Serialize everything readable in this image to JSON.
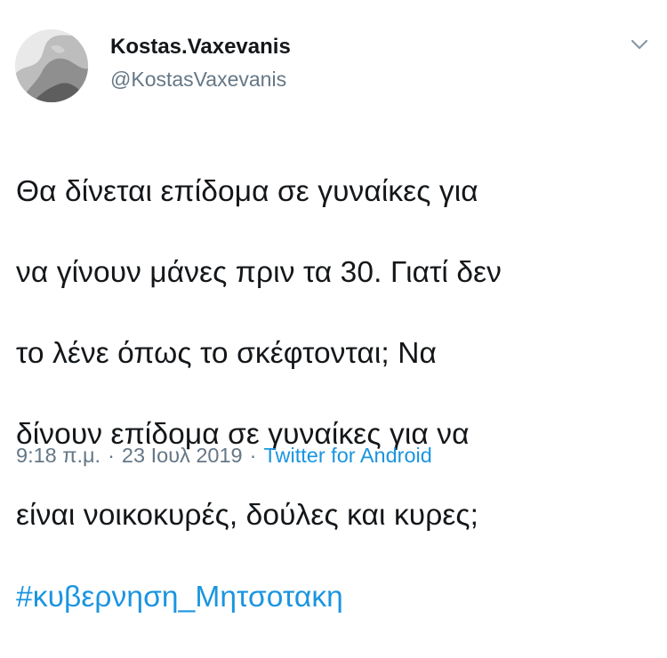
{
  "tweet": {
    "author": {
      "display_name": "Kostas.Vaxevanis",
      "handle": "@KostasVaxevanis"
    },
    "body_lines": [
      "Θα δίνεται επίδομα σε γυναίκες για",
      "να γίνουν μάνες πριν τα 30. Γιατί δεν",
      "το λένε όπως το σκέφτονται; Να",
      "δίνουν επίδομα σε γυναίκες για να",
      "είναι νοικοκυρές, δούλες και κυρες;"
    ],
    "hashtag": "#κυβερνηση_Μητσοτακη",
    "time": "9:18 π.μ.",
    "separator": "·",
    "date": "23 Ιουλ 2019",
    "source": "Twitter for Android"
  },
  "icons": {
    "menu": "chevron-down-icon",
    "avatar": "avatar"
  },
  "colors": {
    "text": "#14171a",
    "secondary": "#657786",
    "link": "#1b95e0",
    "background": "#ffffff"
  }
}
